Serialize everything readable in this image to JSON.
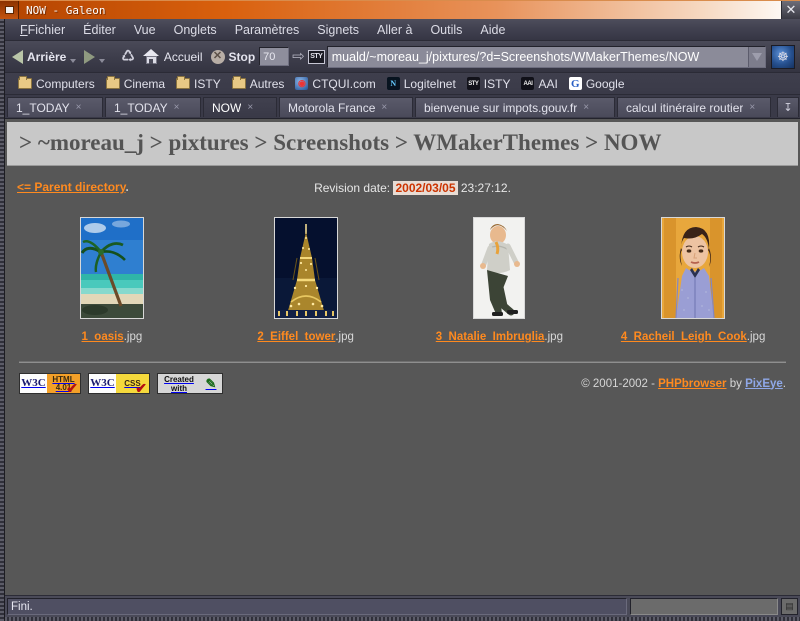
{
  "window": {
    "title": "NOW - Galeon",
    "minimize_glyph": "■",
    "close_glyph": "✕"
  },
  "menubar": {
    "items": [
      {
        "label": "Fichier",
        "accel": "F"
      },
      {
        "label": "Éditer",
        "accel": "d"
      },
      {
        "label": "Vue",
        "accel": "V"
      },
      {
        "label": "Onglets",
        "accel": "O"
      },
      {
        "label": "Paramètres",
        "accel": "P"
      },
      {
        "label": "Signets",
        "accel": "S"
      },
      {
        "label": "Aller à",
        "accel": "l"
      },
      {
        "label": "Outils",
        "accel": "O"
      },
      {
        "label": "Aide",
        "accel": "A"
      }
    ]
  },
  "toolbar": {
    "back_label": "Arrière",
    "forward_label": "",
    "reload_icon": "reload-icon",
    "home_label": "Accueil",
    "stop_label": "Stop",
    "zoom_value": "70",
    "zoom_arrow_glyph": "⇨",
    "site_icon_text": "STY",
    "url_value": "muald/~moreau_j/pixtures/?d=Screenshots/WMakerThemes/NOW",
    "throbber_glyph": "☸"
  },
  "bookmarks": {
    "items": [
      {
        "label": "Computers",
        "icon": "folder-icon",
        "kind": "folder"
      },
      {
        "label": "Cinema",
        "icon": "folder-icon",
        "kind": "folder"
      },
      {
        "label": "ISTY",
        "icon": "folder-icon",
        "kind": "folder"
      },
      {
        "label": "Autres",
        "icon": "folder-icon",
        "kind": "folder"
      },
      {
        "label": "CTQUI.com",
        "icon": "ctqui-favicon",
        "kind": "ctqui",
        "glyph": "◉"
      },
      {
        "label": "Logitelnet",
        "icon": "logitelnet-favicon",
        "kind": "logitelnet",
        "glyph": "N"
      },
      {
        "label": "ISTY",
        "icon": "isty-favicon",
        "kind": "isty",
        "glyph": "STY"
      },
      {
        "label": "AAI",
        "icon": "aai-favicon",
        "kind": "aai",
        "glyph": "AAI"
      },
      {
        "label": "Google",
        "icon": "google-favicon",
        "kind": "google",
        "glyph": "G"
      }
    ]
  },
  "tabs": {
    "close_glyph": "×",
    "scroll_glyph": "↧",
    "items": [
      {
        "label": "1_TODAY",
        "active": false
      },
      {
        "label": "1_TODAY",
        "active": false
      },
      {
        "label": "NOW",
        "active": true
      },
      {
        "label": "Motorola France",
        "active": false
      },
      {
        "label": "bienvenue sur impots.gouv.fr",
        "active": false
      },
      {
        "label": "calcul itinéraire routier",
        "active": false
      }
    ]
  },
  "page": {
    "breadcrumb": "> ~moreau_j > pixtures > Screenshots > WMakerThemes > NOW",
    "parent_link": "<= Parent directory",
    "parent_suffix": ".",
    "revision_label": "Revision date:",
    "revision_date": "2002/03/05",
    "revision_time": "23:27:12.",
    "thumbnails": [
      {
        "stem": "1_oasis",
        "ext": ".jpg",
        "alt": "beach with palm tree"
      },
      {
        "stem": "2_Eiffel_tower",
        "ext": ".jpg",
        "alt": "eiffel tower at night"
      },
      {
        "stem": "3_Natalie_Imbruglia",
        "ext": ".jpg",
        "alt": "portrait on white"
      },
      {
        "stem": "4_Racheil_Leigh_Cook",
        "ext": ".jpg",
        "alt": "portrait on orange"
      }
    ],
    "badges": [
      {
        "kind": "html",
        "left": "W3C",
        "line1": "HTML",
        "line2": "4.01",
        "tick": "✔"
      },
      {
        "kind": "css",
        "left": "W3C",
        "line1": "CSS",
        "line2": "",
        "tick": "✔"
      },
      {
        "kind": "vim",
        "left1": "Created",
        "left2": "with",
        "right": "✎"
      }
    ],
    "copyright_prefix": "© 2001-2002 - ",
    "copyright_app": "PHPbrowser",
    "copyright_mid": " by ",
    "copyright_author": "PixEye",
    "copyright_suffix": "."
  },
  "statusbar": {
    "text": "Fini.",
    "lock_glyph": "▤"
  },
  "colors": {
    "titlebar_orange": "#d9600d",
    "link_orange": "#ff8a1f",
    "page_background": "#575757",
    "breadcrumb_band": "#c8c8c8",
    "revision_red": "#cc3300",
    "author_blue": "#8fa8e8"
  }
}
